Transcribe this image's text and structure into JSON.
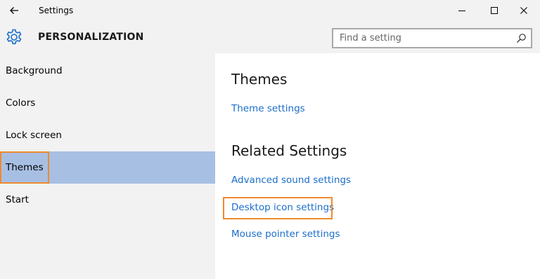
{
  "titlebar": {
    "title": "Settings",
    "icons": [
      "back-arrow-icon",
      "minimize-icon",
      "maximize-icon",
      "close-icon"
    ]
  },
  "header": {
    "title": "PERSONALIZATION",
    "icon": "gear-icon"
  },
  "search": {
    "placeholder": "Find a setting",
    "value": "",
    "icon": "search-icon"
  },
  "sidebar": {
    "items": [
      {
        "label": "Background",
        "selected": false
      },
      {
        "label": "Colors",
        "selected": false
      },
      {
        "label": "Lock screen",
        "selected": false
      },
      {
        "label": "Themes",
        "selected": true
      },
      {
        "label": "Start",
        "selected": false
      }
    ]
  },
  "content": {
    "themes_heading": "Themes",
    "theme_settings_link": "Theme settings",
    "related_heading": "Related Settings",
    "related_links": [
      "Advanced sound settings",
      "Desktop icon settings",
      "Mouse pointer settings"
    ]
  },
  "colors": {
    "accent": "#1a6ec9",
    "selection": "#a7bfe3",
    "highlight_outline": "#f0892e",
    "chrome": "#f2f2f2"
  }
}
